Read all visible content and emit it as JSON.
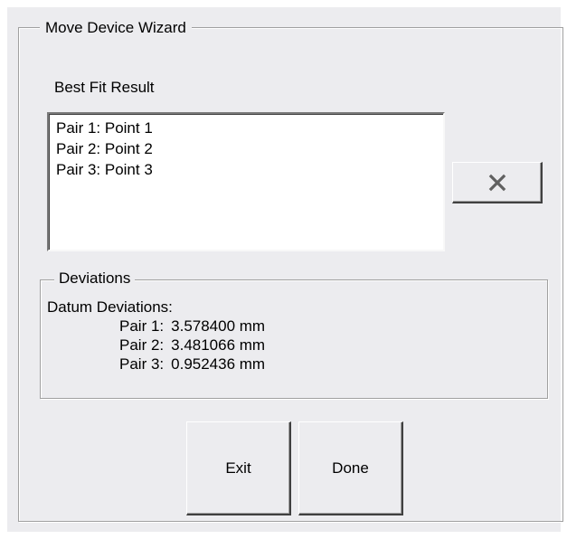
{
  "wizard": {
    "title": "Move Device Wizard",
    "best_fit_label": "Best Fit Result",
    "list_items": [
      "Pair 1: Point 1",
      "Pair 2: Point 2",
      "Pair 3: Point 3"
    ],
    "delete_icon": "x-icon"
  },
  "deviations": {
    "title": "Deviations",
    "header": "Datum Deviations:",
    "rows": [
      {
        "label": "Pair 1:",
        "value": "3.578400 mm"
      },
      {
        "label": "Pair 2:",
        "value": "3.481066 mm"
      },
      {
        "label": "Pair 3:",
        "value": "0.952436 mm"
      }
    ]
  },
  "buttons": {
    "exit_label": "Exit",
    "done_label": "Done"
  }
}
